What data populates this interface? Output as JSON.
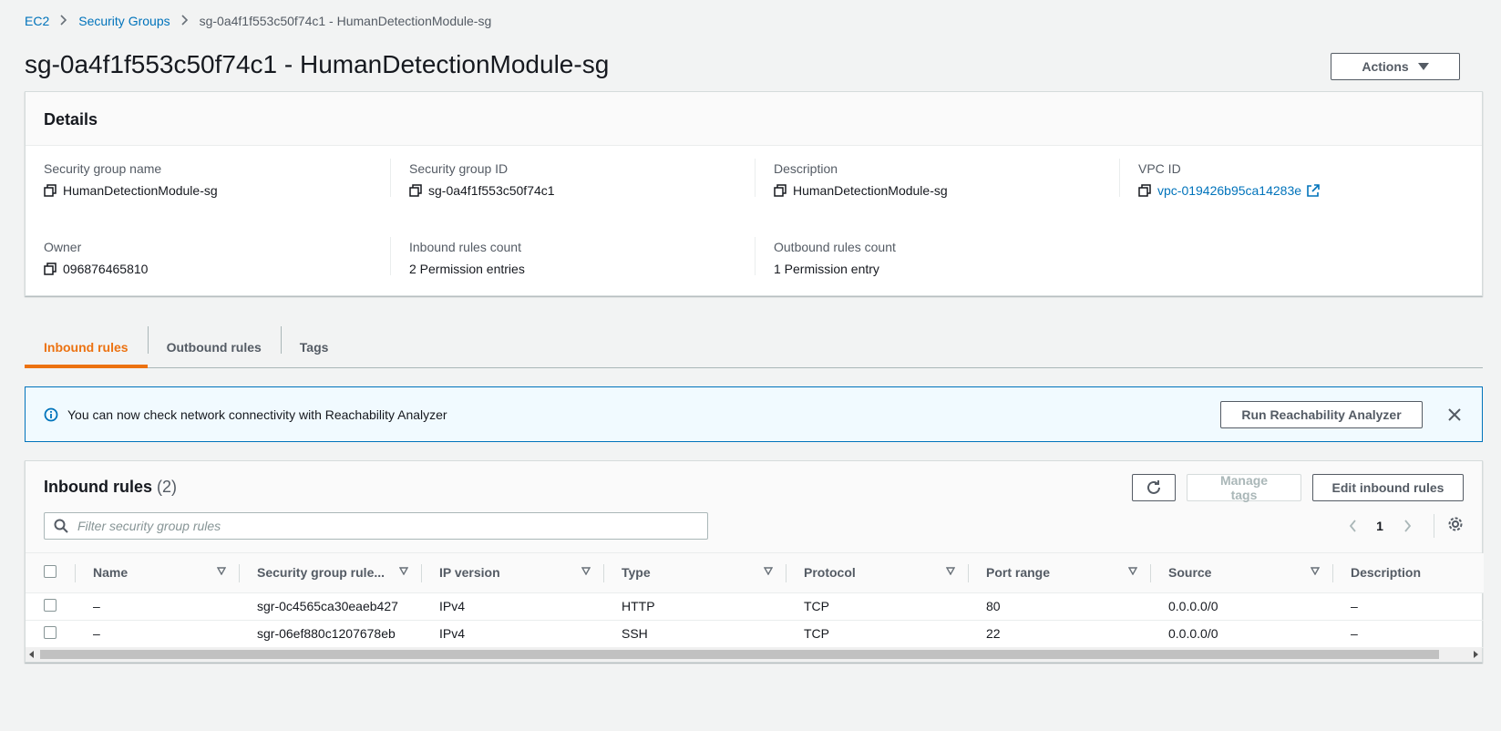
{
  "breadcrumb": {
    "items": [
      "EC2",
      "Security Groups"
    ],
    "current": "sg-0a4f1f553c50f74c1 - HumanDetectionModule-sg"
  },
  "page": {
    "title": "sg-0a4f1f553c50f74c1 - HumanDetectionModule-sg",
    "actions_label": "Actions"
  },
  "details": {
    "header": "Details",
    "fields": {
      "sg_name": {
        "label": "Security group name",
        "value": "HumanDetectionModule-sg"
      },
      "sg_id": {
        "label": "Security group ID",
        "value": "sg-0a4f1f553c50f74c1"
      },
      "description": {
        "label": "Description",
        "value": "HumanDetectionModule-sg"
      },
      "vpc_id": {
        "label": "VPC ID",
        "value": "vpc-019426b95ca14283e"
      },
      "owner": {
        "label": "Owner",
        "value": "096876465810"
      },
      "inbound_count": {
        "label": "Inbound rules count",
        "value": "2 Permission entries"
      },
      "outbound_count": {
        "label": "Outbound rules count",
        "value": "1 Permission entry"
      }
    }
  },
  "tabs": [
    "Inbound rules",
    "Outbound rules",
    "Tags"
  ],
  "flash": {
    "text": "You can now check network connectivity with Reachability Analyzer",
    "button": "Run Reachability Analyzer"
  },
  "rules": {
    "title": "Inbound rules",
    "count": "(2)",
    "manage_tags": "Manage tags",
    "edit": "Edit inbound rules",
    "search_placeholder": "Filter security group rules",
    "page": "1",
    "columns": [
      "Name",
      "Security group rule...",
      "IP version",
      "Type",
      "Protocol",
      "Port range",
      "Source",
      "Description"
    ],
    "rows": [
      [
        "–",
        "sgr-0c4565ca30eaeb427",
        "IPv4",
        "HTTP",
        "TCP",
        "80",
        "0.0.0.0/0",
        "–"
      ],
      [
        "–",
        "sgr-06ef880c1207678eb",
        "IPv4",
        "SSH",
        "TCP",
        "22",
        "0.0.0.0/0",
        "–"
      ]
    ]
  },
  "colors": {
    "accent_orange": "#ec7211",
    "link_blue": "#0073bb",
    "info_bg": "#f1faff"
  }
}
